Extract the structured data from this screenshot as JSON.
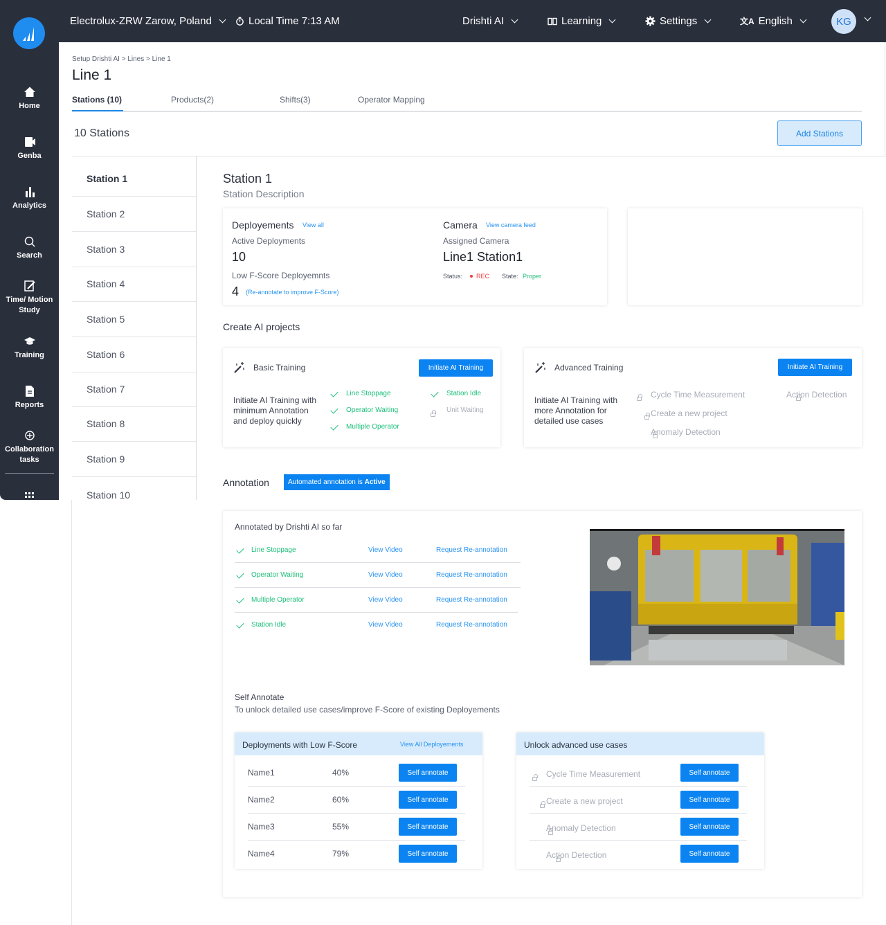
{
  "topbar": {
    "plant": "Electrolux-ZRW Zarow, Poland",
    "local_time": "Local Time 7:13 AM",
    "drishti": "Drishti AI",
    "learning": "Learning",
    "settings": "Settings",
    "language": "English",
    "avatar": "KG"
  },
  "sidebar": {
    "home": "Home",
    "genba": "Genba",
    "analytics": "Analytics",
    "search": "Search",
    "time_motion_1": "Time/ Motion",
    "time_motion_2": "Study",
    "training": "Training",
    "reports": "Reports",
    "collab_1": "Collaboration",
    "collab_2": "tasks"
  },
  "breadcrumb": "Setup Drishti AI > Lines > Line 1",
  "page_title": "Line 1",
  "tabs": [
    "Stations (10)",
    "Products(2)",
    "Shifts(3)",
    "Operator Mapping"
  ],
  "stations_count": "10 Stations",
  "add_stations": "Add Stations",
  "stations": [
    "Station 1",
    "Station 2",
    "Station 3",
    "Station 4",
    "Station 5",
    "Station 6",
    "Station 7",
    "Station 8",
    "Station 9",
    "Station 10"
  ],
  "detail": {
    "title": "Station 1",
    "description": "Station Description",
    "deployments_title": "Deployements",
    "view_all": "View all",
    "active_label": "Active Deployments",
    "active_value": "10",
    "low_label": "Low F-Score Deployemnts",
    "low_value": "4",
    "reannotate": "(Re-annotate to improve F-Score)",
    "camera_title": "Camera",
    "view_camera": "View camera feed",
    "assigned_label": "Assigned Camera",
    "camera_name": "Line1 Station1",
    "status_label": "Status:",
    "status_value": "REC",
    "state_label": "State:",
    "state_value": "Proper"
  },
  "create_ai": "Create AI projects",
  "basic": {
    "title": "Basic Training",
    "button": "Initiate AI Training",
    "desc_1": "Initiate AI Training with",
    "desc_2": "minimum Annotation",
    "desc_3": "and deploy quickly",
    "items_left": [
      "Line Stoppage",
      "Operator Waiting",
      "Multiple Operator"
    ],
    "items_right": [
      "Station Idle",
      "Unit Waiting"
    ]
  },
  "advanced": {
    "title": "Advanced Training",
    "button": "Initiate AI Training",
    "desc_1": "Initiate AI Training with",
    "desc_2": "more Annotation for",
    "desc_3": "detailed use cases",
    "items_left": [
      "Cycle Time Measurement",
      "Create a new project",
      "Anomaly Detection"
    ],
    "items_right": [
      "Action Detection"
    ]
  },
  "annotation": {
    "title": "Annotation",
    "badge_prefix": "Automated annotation is ",
    "badge_state": "Active",
    "annotated_title": "Annotated by Drishti AI so far",
    "rows": [
      {
        "name": "Line Stoppage",
        "video": "View Video",
        "request": "Request Re-annotation"
      },
      {
        "name": "Operator Waiting",
        "video": "View Video",
        "request": "Request Re-annotation"
      },
      {
        "name": "Multiple Operator",
        "video": "View Video",
        "request": "Request Re-annotation"
      },
      {
        "name": "Station Idle",
        "video": "View Video",
        "request": "Request Re-annotation"
      }
    ],
    "self_title": "Self Annotate",
    "self_sub": "To unlock detailed use cases/improve F-Score of existing Deployements"
  },
  "low_fscore": {
    "title": "Deployments with Low F-Score",
    "view_all": "View All Deployements",
    "rows": [
      {
        "name": "Name1",
        "score": "40%",
        "button": "Self annotate"
      },
      {
        "name": "Name2",
        "score": "60%",
        "button": "Self annotate"
      },
      {
        "name": "Name3",
        "score": "55%",
        "button": "Self annotate"
      },
      {
        "name": "Name4",
        "score": "79%",
        "button": "Self annotate"
      }
    ]
  },
  "unlock": {
    "title": "Unlock advanced use cases",
    "rows": [
      {
        "name": "Cycle Time Measurement",
        "button": "Self annotate"
      },
      {
        "name": "Create a new project",
        "button": "Self annotate"
      },
      {
        "name": "Anomaly Detection",
        "button": "Self annotate"
      },
      {
        "name": "Action Detection",
        "button": "Self annotate"
      }
    ]
  },
  "colors": {
    "accent": "#0b84f2",
    "sidebar": "#2a2f3c",
    "success": "#1dbf7a",
    "rec": "#f03c3c"
  }
}
